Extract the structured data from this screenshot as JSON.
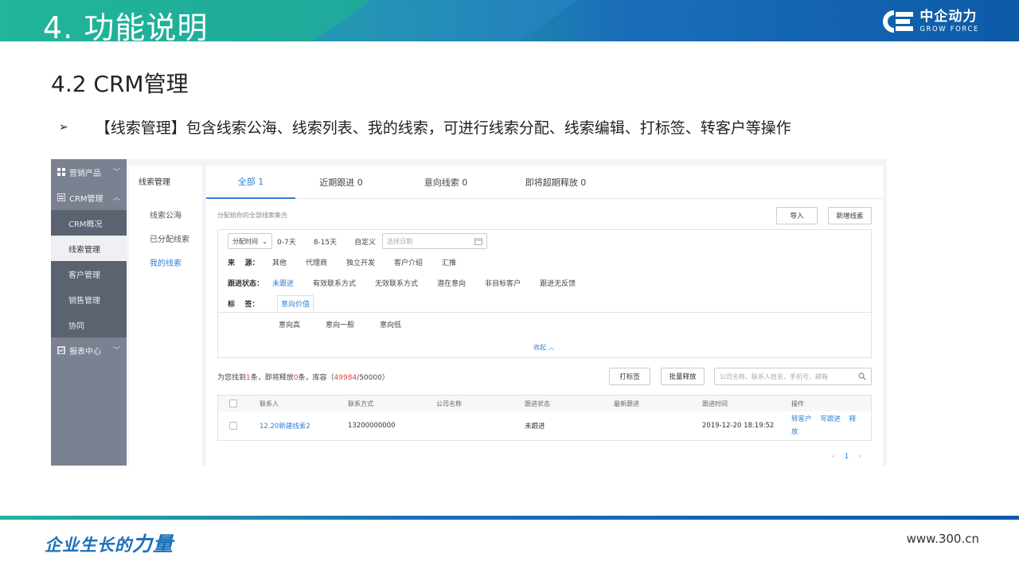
{
  "slide": {
    "title": "4. 功能说明",
    "section": "4.2  CRM管理",
    "bullet_glyph": "➢",
    "bullet_text": "【线索管理】包含线索公海、线索列表、我的线索，可进行线索分配、线索编辑、打标签、转客户等操作",
    "logo_cn": "中企动力",
    "logo_en": "GROW FORCE",
    "slogan_a": "企业生长的",
    "slogan_b": "力量",
    "website": "www.300.cn"
  },
  "colors": {
    "accent": "#2f7fd8",
    "brand": "#1b6fb8",
    "highlight": "#e0443b",
    "nav_bg": "#7a8190"
  },
  "nav": {
    "groups": [
      {
        "label": "营销产品",
        "icon": "grid-icon",
        "chevron": "﹀"
      },
      {
        "label": "CRM管理",
        "icon": "list-icon",
        "chevron": "︿"
      }
    ],
    "crm_items": [
      "CRM概况",
      "线索管理",
      "客户管理",
      "销售管理",
      "协同"
    ],
    "reports": {
      "label": "报表中心",
      "icon": "clipboard-icon",
      "chevron": "﹀"
    }
  },
  "subnav": {
    "title": "线索管理",
    "items": [
      "线索公海",
      "已分配线索",
      "我的线索"
    ]
  },
  "tabs": [
    "全部 1",
    "近期跟进 0",
    "意向线索 0",
    "即将超期释放 0"
  ],
  "hint": "分配给你的全部线索集合",
  "buttons": {
    "import": "导入",
    "new": "新增线索",
    "tag": "打标签",
    "batch_release": "批量释放"
  },
  "filters": {
    "time_select": "分配时间",
    "time_options": [
      "0-7天",
      "8-15天",
      "自定义"
    ],
    "date_placeholder": "选择日期",
    "source_label": "来    源：",
    "source_options": [
      "其他",
      "代理商",
      "独立开发",
      "客户介绍",
      "汇推"
    ],
    "status_label": "跟进状态：",
    "status_options": [
      "未跟进",
      "有效联系方式",
      "无效联系方式",
      "潜在意向",
      "非目标客户",
      "跟进无反馈"
    ],
    "tag_label": "标    签：",
    "tag_tab": "意向价值",
    "tag_options": [
      "意向高",
      "意向一般",
      "意向低"
    ],
    "collapse": "收起 ︿"
  },
  "result": {
    "prefix": "为您找到",
    "found": "1",
    "mid1": "条，即将释放",
    "releasing": "0",
    "mid2": "条，库容（",
    "used": "49984",
    "total": "/50000）"
  },
  "search": {
    "placeholder": "公司名称、联系人姓名、手机号、邮箱"
  },
  "table": {
    "headers": [
      "联系人",
      "联系方式",
      "公司名称",
      "跟进状态",
      "最新跟进",
      "跟进时间",
      "操作"
    ],
    "rows": [
      {
        "contact": "12.20新建线索2",
        "phone": "13200000000",
        "company": "",
        "status": "未跟进",
        "latest": "",
        "time": "2019-12-20 18:19:52",
        "ops": [
          "转客户",
          "写跟进",
          "释",
          "放"
        ]
      }
    ]
  },
  "pager": {
    "prev": "‹",
    "current": "1",
    "next": "›"
  }
}
